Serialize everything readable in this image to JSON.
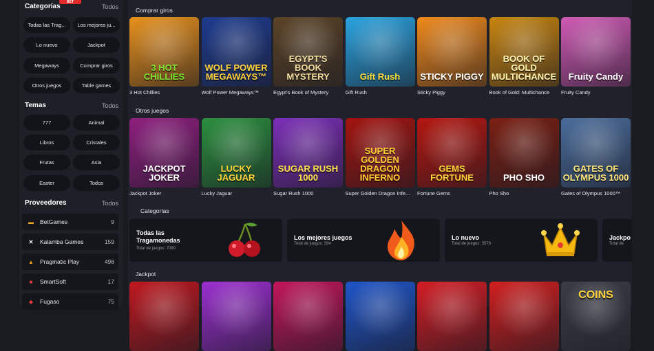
{
  "sidebar": {
    "categorias": {
      "title": "Categorías",
      "all": "Todos",
      "items": [
        "Todas las Trag...",
        "Los mejores ju...",
        "Lo nuevo",
        "Jackpot",
        "Megaways",
        "Comprar giros",
        "Otros juegos",
        "Table games"
      ]
    },
    "temas": {
      "title": "Temas",
      "all": "Todos",
      "items": [
        "777",
        "Animal",
        "Libros",
        "Cristales",
        "Frutas",
        "Asia",
        "Easter",
        "Todos"
      ]
    },
    "proveedores": {
      "title": "Proveedores",
      "all": "Todos",
      "items": [
        {
          "name": "BetGames",
          "count": "9",
          "icon": "betgames-icon",
          "color": "#f5a623"
        },
        {
          "name": "Kalamba Games",
          "count": "159",
          "icon": "kalamba-icon",
          "color": "#ffffff"
        },
        {
          "name": "Pragmatic Play",
          "count": "498",
          "icon": "pragmatic-icon",
          "color": "#f7a21b"
        },
        {
          "name": "SmartSoft",
          "count": "17",
          "icon": "smartsoft-icon",
          "color": "#e53935"
        },
        {
          "name": "Fugaso",
          "count": "75",
          "icon": "fugaso-icon",
          "color": "#e53935"
        }
      ]
    }
  },
  "logo_text": "BET",
  "rows": {
    "comprar": {
      "title": "Comprar giros",
      "games": [
        {
          "name": "3 Hot Chillies",
          "art": "3 HOT CHILLIES",
          "bg": "#e8911c",
          "fg": "#7be032"
        },
        {
          "name": "Wolf Power Megaways™",
          "art": "WOLF POWER MEGAWAYS™",
          "bg": "#1d3b8f",
          "fg": "#ffd23c"
        },
        {
          "name": "Egypt's Book of Mystery",
          "art": "EGYPT'S BOOK MYSTERY",
          "bg": "#5b4326",
          "fg": "#f2dca0"
        },
        {
          "name": "Gift Rush",
          "art": "Gift Rush",
          "bg": "#2aa3e0",
          "fg": "#ffde3a"
        },
        {
          "name": "Sticky Piggy",
          "art": "STICKY PIGGY",
          "bg": "#f08a1c",
          "fg": "#ffffff"
        },
        {
          "name": "Book of Gold: Multichance",
          "art": "BOOK OF GOLD MULTICHANCE",
          "bg": "#c8850f",
          "fg": "#fff3b0"
        },
        {
          "name": "Fruity Candy",
          "art": "Fruity Candy",
          "bg": "#d05ab5",
          "fg": "#ffffff"
        }
      ]
    },
    "otros": {
      "title": "Otros juegos",
      "games": [
        {
          "name": "Jackpot Joker",
          "art": "JACKPOT JOKER",
          "bg": "#8e1f7f",
          "fg": "#ffffff"
        },
        {
          "name": "Lucky Jaguar",
          "art": "LUCKY JAGUAR",
          "bg": "#2a8f3d",
          "fg": "#ffd23c"
        },
        {
          "name": "Sugar Rush 1000",
          "art": "SUGAR RUSH 1000",
          "bg": "#7c2fb8",
          "fg": "#ffe14d"
        },
        {
          "name": "Super Golden Dragon Infe...",
          "art": "SUPER GOLDEN DRAGON INFERNO",
          "bg": "#a3140f",
          "fg": "#ffcc33"
        },
        {
          "name": "Fortune Gems",
          "art": "GEMS FORTUNE",
          "bg": "#b5170f",
          "fg": "#ffd43a"
        },
        {
          "name": "Pho Sho",
          "art": "PHO SHO",
          "bg": "#7a1f12",
          "fg": "#ffffff"
        },
        {
          "name": "Gates of Olympus 1000™",
          "art": "GATES OF OLYMPUS 1000",
          "bg": "#4a6d9c",
          "fg": "#ffe47a"
        }
      ]
    },
    "jackpot": {
      "title": "Jackpot",
      "games": [
        {
          "bg": "#c0181f"
        },
        {
          "bg": "#9c2fd1"
        },
        {
          "bg": "#c3165b"
        },
        {
          "bg": "#1f55c9"
        },
        {
          "bg": "#d41d24"
        },
        {
          "bg": "#d21f1f"
        },
        {
          "bg": "#3b3d46"
        }
      ],
      "last_art": "COINS"
    }
  },
  "categorias": {
    "title": "Categorías",
    "cards": [
      {
        "title": "Todas las Tragamonedas",
        "sub": "Total de juegos: 7090",
        "icon": "cherries-icon"
      },
      {
        "title": "Los mejores juegos",
        "sub": "Total de juegos: 284",
        "icon": "fire-icon"
      },
      {
        "title": "Lo nuevo",
        "sub": "Total de juegos: 3576",
        "icon": "crown-icon"
      },
      {
        "title": "Jackpo",
        "sub": "Total de",
        "icon": "jackpot-icon"
      }
    ]
  }
}
